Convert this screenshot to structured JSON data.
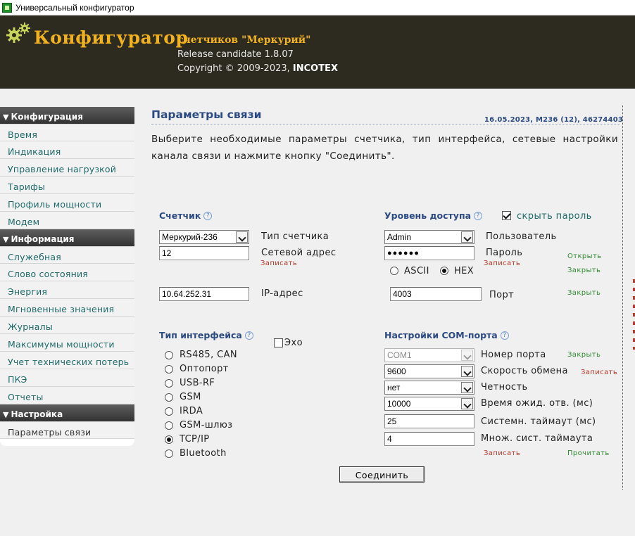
{
  "window": {
    "title": "Универсальный конфигуратор"
  },
  "header": {
    "brand": "Конфигуратор",
    "subtitle": "счетчиков \"Меркурий\"",
    "release": "Release candidate 1.8.07",
    "copyright": "Copyright © 2009-2023,",
    "company": "INCOTEX",
    "accent_color": "#f2b21c",
    "bg_color": "#2d2a1f",
    "logo_icon": "gears-icon"
  },
  "sidebar": {
    "sections": [
      {
        "title": "Конфигурация",
        "items": [
          "Время",
          "Индикация",
          "Управление нагрузкой",
          "Тарифы",
          "Профиль мощности",
          "Модем"
        ]
      },
      {
        "title": "Информация",
        "items": [
          "Служебная",
          "Слово состояния",
          "Энергия",
          "Мгновенные значения",
          "Журналы",
          "Максимумы мощности",
          "Учет технических потерь",
          "ПКЭ",
          "Отчеты"
        ]
      },
      {
        "title": "Настройка",
        "items": [
          "Параметры связи"
        ]
      }
    ]
  },
  "main": {
    "title": "Параметры связи",
    "datestamp": "16.05.2023, M236 (12), 46274403",
    "intro": "Выберите необходимые параметры счетчика, тип интерфейса, сетевые настройки канала связи и нажмите кнопку \"Соединить\".",
    "meter": {
      "title": "Счетчик",
      "type_value": "Меркурий-236",
      "type_label": "Тип счетчика",
      "address_value": "12",
      "address_label": "Сетевой адрес",
      "write": "Записать",
      "ip_value": "10.64.252.31",
      "ip_label": "IP-адрес"
    },
    "access": {
      "title": "Уровень доступа",
      "hide_password_label": "скрыть пароль",
      "hide_password_checked": true,
      "user_value": "Admin",
      "user_label": "Пользователь",
      "password_value": "●●●●●●",
      "password_label": "Пароль",
      "open": "Открыть",
      "write": "Записать",
      "close": "Закрыть",
      "ascii_label": "ASCII",
      "hex_label": "HEX",
      "encoding_selected": "HEX",
      "port_value": "4003",
      "port_label": "Порт",
      "port_close": "Закрыть"
    },
    "interface": {
      "title": "Тип интерфейса",
      "echo_label": "Эхо",
      "echo_checked": false,
      "options": [
        "RS485, CAN",
        "Оптопорт",
        "USB-RF",
        "GSM",
        "IRDA",
        "GSM-шлюз",
        "TCP/IP",
        "Bluetooth"
      ],
      "selected": "TCP/IP"
    },
    "com": {
      "title": "Настройки COM-порта",
      "port_value": "COM1",
      "port_label": "Номер порта",
      "port_close": "Закрыть",
      "speed_value": "9600",
      "speed_label": "Скорость обмена",
      "speed_write": "Записать",
      "parity_value": "нет",
      "parity_label": "Четность",
      "timeout_value": "10000",
      "timeout_label": "Время ожид. отв. (мс)",
      "sys_timeout_value": "25",
      "sys_timeout_label": "Системн. таймаут (мс)",
      "mult_value": "4",
      "mult_label": "Множ. сист. таймаута",
      "write": "Записать",
      "read": "Прочитать"
    },
    "connect_button": "Соединить"
  }
}
